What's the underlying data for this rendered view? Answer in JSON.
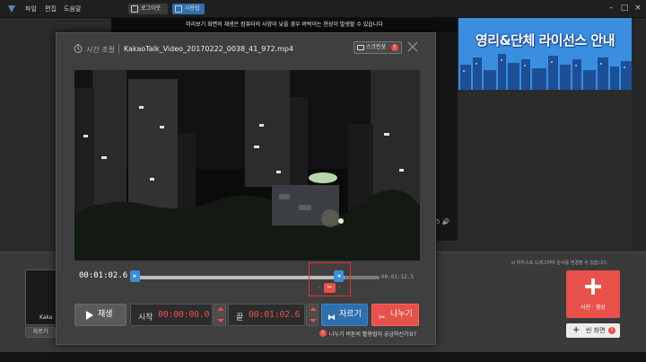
{
  "menu": {
    "file": "파일",
    "edit": "편집",
    "help": "도움말"
  },
  "topbar": {
    "logout_label": "로그아웃",
    "guide_label": "사용법"
  },
  "preview": {
    "notice": "미리보기 화면의 재생은 컴퓨터의 사양이 낮을 경우 버벅이는 현상이 발생할 수 있습니다"
  },
  "banner": {
    "text": "영리&단체 라이선스 안내"
  },
  "timeline": {
    "hint": "마우스로 드래그하여 순서를 변경할 수 있습니다.",
    "clip_label": "Kaka",
    "cut_button": "자르기",
    "add_button": "사진 · 영상",
    "blank_button": "빈 화면"
  },
  "modal": {
    "title": "시간 조절",
    "filename": "KakaoTalk_Video_20170222_0038_41_972.mp4",
    "screenshot_label": "스크린샷",
    "current_time": "00:01:02.6",
    "end_time": "00:01:12.5",
    "range_end_fraction": 0.86,
    "play_label": "재생",
    "start_label": "시작",
    "start_value": "00:00:00.0",
    "end_label": "끝",
    "end_value": "00:01:02.6",
    "cut_label": "자르기",
    "split_label": "나누기",
    "split_hint": "나누기 버튼의 활용법이 궁금하신가요?"
  },
  "colors": {
    "accent_red": "#e8504a",
    "accent_blue": "#2f6fae",
    "banner_blue": "#2e7fd0"
  },
  "icons": [
    "app-logo-icon",
    "clock-icon",
    "camera-icon",
    "close-icon",
    "play-icon",
    "scissors-icon",
    "cut-icon",
    "plus-icon",
    "info-icon",
    "volume-icon"
  ]
}
